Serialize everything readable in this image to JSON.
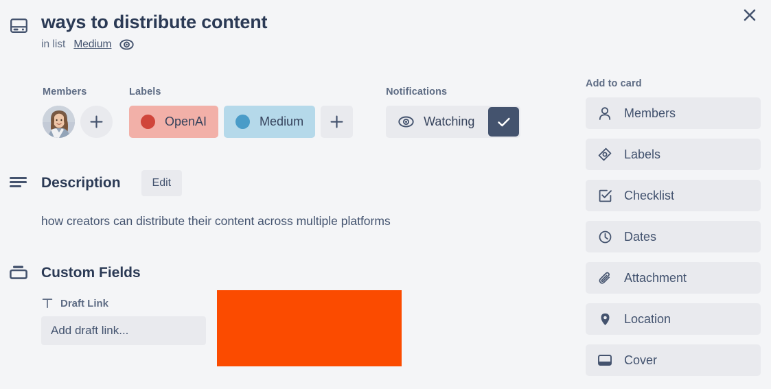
{
  "window": {
    "close_icon": "close-icon"
  },
  "header": {
    "icon": "card-icon",
    "title": "ways to distribute content",
    "in_list_prefix": "in list",
    "list_name": "Medium",
    "watch_icon": "eye-icon"
  },
  "meta": {
    "members": {
      "heading": "Members",
      "avatar": "member-avatar",
      "add_label": "+"
    },
    "labels": {
      "heading": "Labels",
      "chips": [
        {
          "name": "OpenAI",
          "bg": "#f2b0a8",
          "dot": "#d0453a"
        },
        {
          "name": "Medium",
          "bg": "#b5d9ea",
          "dot": "#4a9cc8"
        }
      ],
      "add_label": "+"
    },
    "notifications": {
      "heading": "Notifications",
      "watch_label": "Watching",
      "watch_icon": "eye-icon",
      "check_icon": "check-icon",
      "check_bg": "#44536e"
    }
  },
  "description": {
    "icon": "description-lines-icon",
    "title": "Description",
    "edit_label": "Edit",
    "body": "how creators can distribute their content across multiple platforms"
  },
  "custom_fields": {
    "icon": "custom-fields-icon",
    "title": "Custom Fields",
    "fields": [
      {
        "icon": "text-field-icon",
        "name": "Draft Link",
        "value": "",
        "placeholder": "Add draft link..."
      }
    ]
  },
  "overlay": {
    "name": "orange-block",
    "color": "#fb4b00"
  },
  "sidebar": {
    "heading": "Add to card",
    "items": [
      {
        "icon": "person-icon",
        "label": "Members"
      },
      {
        "icon": "tag-icon",
        "label": "Labels"
      },
      {
        "icon": "checklist-icon",
        "label": "Checklist"
      },
      {
        "icon": "clock-icon",
        "label": "Dates"
      },
      {
        "icon": "paperclip-icon",
        "label": "Attachment"
      },
      {
        "icon": "location-pin-icon",
        "label": "Location"
      },
      {
        "icon": "cover-icon",
        "label": "Cover"
      }
    ]
  },
  "colors": {
    "background": "#f4f5f7",
    "surface": "#e9eaee",
    "text_dark": "#2b3a55",
    "text_muted": "#5e6c84"
  }
}
